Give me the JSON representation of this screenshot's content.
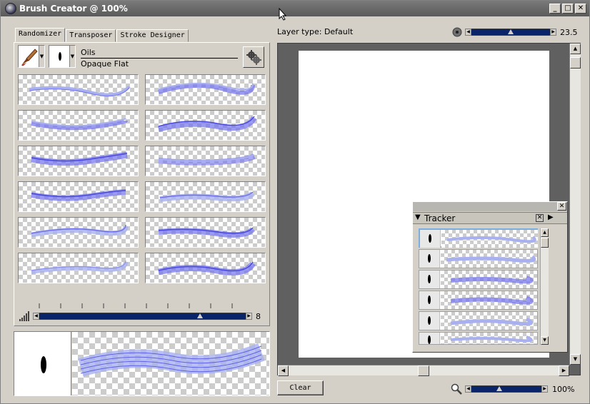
{
  "window": {
    "title": "Brush Creator @ 100%"
  },
  "tabs": [
    "Randomizer",
    "Transposer",
    "Stroke Designer"
  ],
  "brush": {
    "category": "Oils",
    "variant": "Opaque Flat"
  },
  "randomizer": {
    "slider_value": "8",
    "slider_level": 0.78
  },
  "canvas": {
    "layer_type": "Layer type: Default",
    "size_value": "23.5",
    "size_level": 0.5,
    "zoom_value": "100%",
    "zoom_level": 0.4,
    "clear_label": "Clear"
  },
  "tracker": {
    "title": "Tracker"
  },
  "colors": {
    "stroke": "#7070ee",
    "stroke_light": "#a8b0f0",
    "slider": "#0a246a"
  }
}
